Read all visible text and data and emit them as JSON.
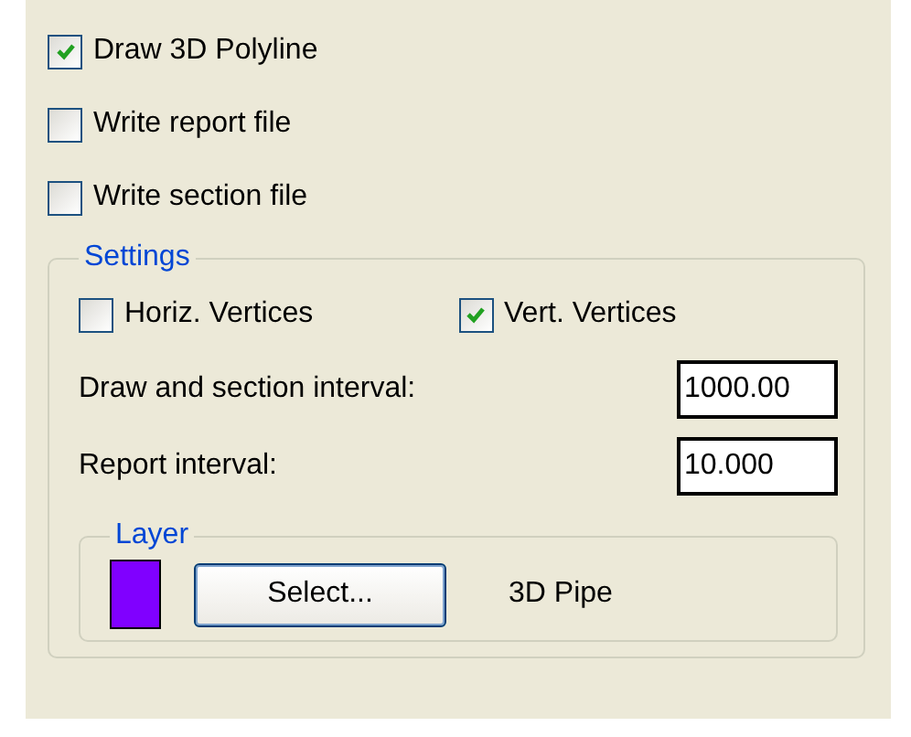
{
  "options": [
    {
      "label": "Draw 3D Polyline",
      "checked": true
    },
    {
      "label": "Write report file",
      "checked": false
    },
    {
      "label": "Write section file",
      "checked": false
    }
  ],
  "settings": {
    "title": "Settings",
    "vertices": [
      {
        "label": "Horiz. Vertices",
        "checked": false
      },
      {
        "label": "Vert. Vertices",
        "checked": true
      }
    ],
    "fields": [
      {
        "label": "Draw and section interval:",
        "value": "1000.00"
      },
      {
        "label": "Report interval:",
        "value": "10.000"
      }
    ],
    "layer": {
      "title": "Layer",
      "color": "#8000ff",
      "button": "Select...",
      "name": "3D Pipe"
    }
  }
}
